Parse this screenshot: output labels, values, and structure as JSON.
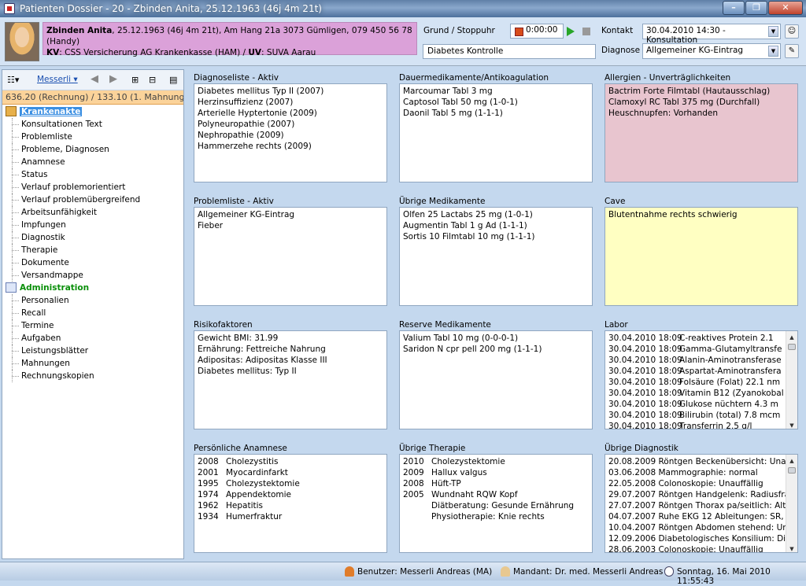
{
  "window": {
    "title": "Patienten Dossier - 20 - Zbinden Anita, 25.12.1963 (46j 4m 21t)"
  },
  "patient": {
    "name": "Zbinden Anita",
    "details": ", 25.12.1963 (46j 4m 21t), Am Hang 21a 3073 Gümligen, 079 450 56 78 (Handy)",
    "kv_label": "KV",
    "kv_value": ": CSS Versicherung AG Krankenkasse (HAM) / ",
    "uv_label": "UV",
    "uv_value": ": SUVA Aarau"
  },
  "header": {
    "grund_label": "Grund / Stoppuhr",
    "timer": "0:00:00",
    "grund_value": "Diabetes Kontrolle",
    "kontakt_label": "Kontakt",
    "kontakt_value": "30.04.2010 14:30 - Konsultation",
    "diagnose_label": "Diagnose",
    "diagnose_value": "Allgemeiner KG-Eintrag"
  },
  "sidebar": {
    "user": "Messerli",
    "amount": "636.20 (Rechnung) / 133.10 (1. Mahnung",
    "root1": "Krankenakte",
    "items1": [
      "Konsultationen Text",
      "Problemliste",
      "Probleme, Diagnosen",
      "Anamnese",
      "Status",
      "Verlauf problemorientiert",
      "Verlauf problemübergreifend",
      "Arbeitsunfähigkeit",
      "Impfungen",
      "Diagnostik",
      "Therapie",
      "Dokumente",
      "Versandmappe"
    ],
    "root2": "Administration",
    "items2": [
      "Personalien",
      "Recall",
      "Termine",
      "Aufgaben",
      "Leistungsblätter",
      "Mahnungen",
      "Rechnungskopien"
    ]
  },
  "panels": {
    "diagnoseliste": {
      "title": "Diagnoseliste - Aktiv",
      "lines": [
        "Diabetes mellitus Typ II (2007)",
        "Herzinsuffizienz (2007)",
        "Arterielle Hyptertonie (2009)",
        "Polyneuropathie (2007)",
        "Nephropathie (2009)",
        "Hammerzehe rechts (2009)"
      ]
    },
    "dauermedikamente": {
      "title": "Dauermedikamente/Antikoagulation",
      "lines": [
        "Marcoumar Tabl 3 mg",
        "Captosol Tabl 50 mg (1-0-1)",
        "Daonil Tabl 5 mg (1-1-1)"
      ]
    },
    "allergien": {
      "title": "Allergien - Unverträglichkeiten",
      "lines": [
        "Bactrim Forte Filmtabl (Hautausschlag)",
        "Clamoxyl RC Tabl 375 mg (Durchfall)",
        "Heuschnupfen: Vorhanden"
      ]
    },
    "problemliste": {
      "title": "Problemliste - Aktiv",
      "lines": [
        "Allgemeiner KG-Eintrag",
        "Fieber"
      ]
    },
    "uebrige_medikamente": {
      "title": "Übrige Medikamente",
      "lines": [
        "Olfen 25 Lactabs 25 mg (1-0-1)",
        "Augmentin Tabl 1 g Ad (1-1-1)",
        "Sortis 10 Filmtabl 10 mg (1-1-1)"
      ]
    },
    "cave": {
      "title": "Cave",
      "lines": [
        "Blutentnahme rechts schwierig"
      ]
    },
    "risikofaktoren": {
      "title": "Risikofaktoren",
      "lines": [
        "Gewicht BMI: 31.99",
        "Ernährung: Fettreiche Nahrung",
        "Adipositas: Adipositas Klasse III",
        "Diabetes mellitus: Typ II"
      ]
    },
    "reserve": {
      "title": "Reserve Medikamente",
      "lines": [
        "Valium Tabl 10 mg (0-0-0-1)",
        "Saridon N  cpr pell 200 mg (1-1-1)"
      ]
    },
    "labor": {
      "title": "Labor",
      "rows": [
        [
          "30.04.2010 18:09",
          "C-reaktives Protein  2.1"
        ],
        [
          "30.04.2010 18:09",
          "Gamma-Glutamyltransfe"
        ],
        [
          "30.04.2010 18:09",
          "Alanin-Aminotransferase"
        ],
        [
          "30.04.2010 18:09",
          "Aspartat-Aminotransfera"
        ],
        [
          "30.04.2010 18:09",
          "Folsäure (Folat)  22.1 nm"
        ],
        [
          "30.04.2010 18:09",
          "Vitamin B12 (Zyanokobal"
        ],
        [
          "30.04.2010 18:09",
          "Glukose nüchtern  4.3 m"
        ],
        [
          "30.04.2010 18:09",
          "Bilirubin (total)  7.8 mcm"
        ],
        [
          "30.04.2010 18:09",
          "Transferrin  2.5 g/l"
        ]
      ]
    },
    "anamnese": {
      "title": "Persönliche Anamnese",
      "rows": [
        [
          "2008",
          "Cholezystitis"
        ],
        [
          "2001",
          "Myocardinfarkt"
        ],
        [
          "1995",
          "Cholezystektomie"
        ],
        [
          "1974",
          "Appendektomie"
        ],
        [
          "1962",
          "Hepatitis"
        ],
        [
          "1934",
          "Humerfraktur"
        ]
      ]
    },
    "therapie": {
      "title": "Übrige Therapie",
      "rows": [
        [
          "2010",
          "Cholezystektomie"
        ],
        [
          "2009",
          "Hallux valgus"
        ],
        [
          "2008",
          "Hüft-TP"
        ],
        [
          "2005",
          "Wundnaht RQW Kopf"
        ],
        [
          "",
          "Diätberatung: Gesunde Ernährung"
        ],
        [
          "",
          "Physiotherapie: Knie rechts"
        ]
      ]
    },
    "diagnostik": {
      "title": "Übrige Diagnostik",
      "lines": [
        "20.08.2009 Röntgen Beckenübersicht: Una",
        "03.06.2008 Mammographie: normal",
        "22.05.2008 Colonoskopie: Unauffällig",
        "29.07.2007 Röntgen Handgelenk: Radiusfra",
        "27.07.2007 Röntgen Thorax pa/seitlich: Alte",
        "04.07.2007 Ruhe EKG 12 Ableitungen: SR,",
        "10.04.2007 Röntgen Abdomen stehend: Un",
        "12.09.2006 Diabetologisches Konsilium: Di",
        "28.06.2003 Colonoskopie: Unauffällig"
      ]
    }
  },
  "status": {
    "user": "Benutzer: Messerli Andreas   (MA)",
    "mandant": "Mandant: Dr. med. Messerli Andreas",
    "datetime": "Sonntag, 16. Mai 2010 11:55:43"
  },
  "colors": {
    "patient_bg": "#dba1d9",
    "allergy_bg": "#e8c5cf",
    "cave_bg": "#ffffc2",
    "selection": "#3b8fe2",
    "admin": "#0a8f0a"
  }
}
